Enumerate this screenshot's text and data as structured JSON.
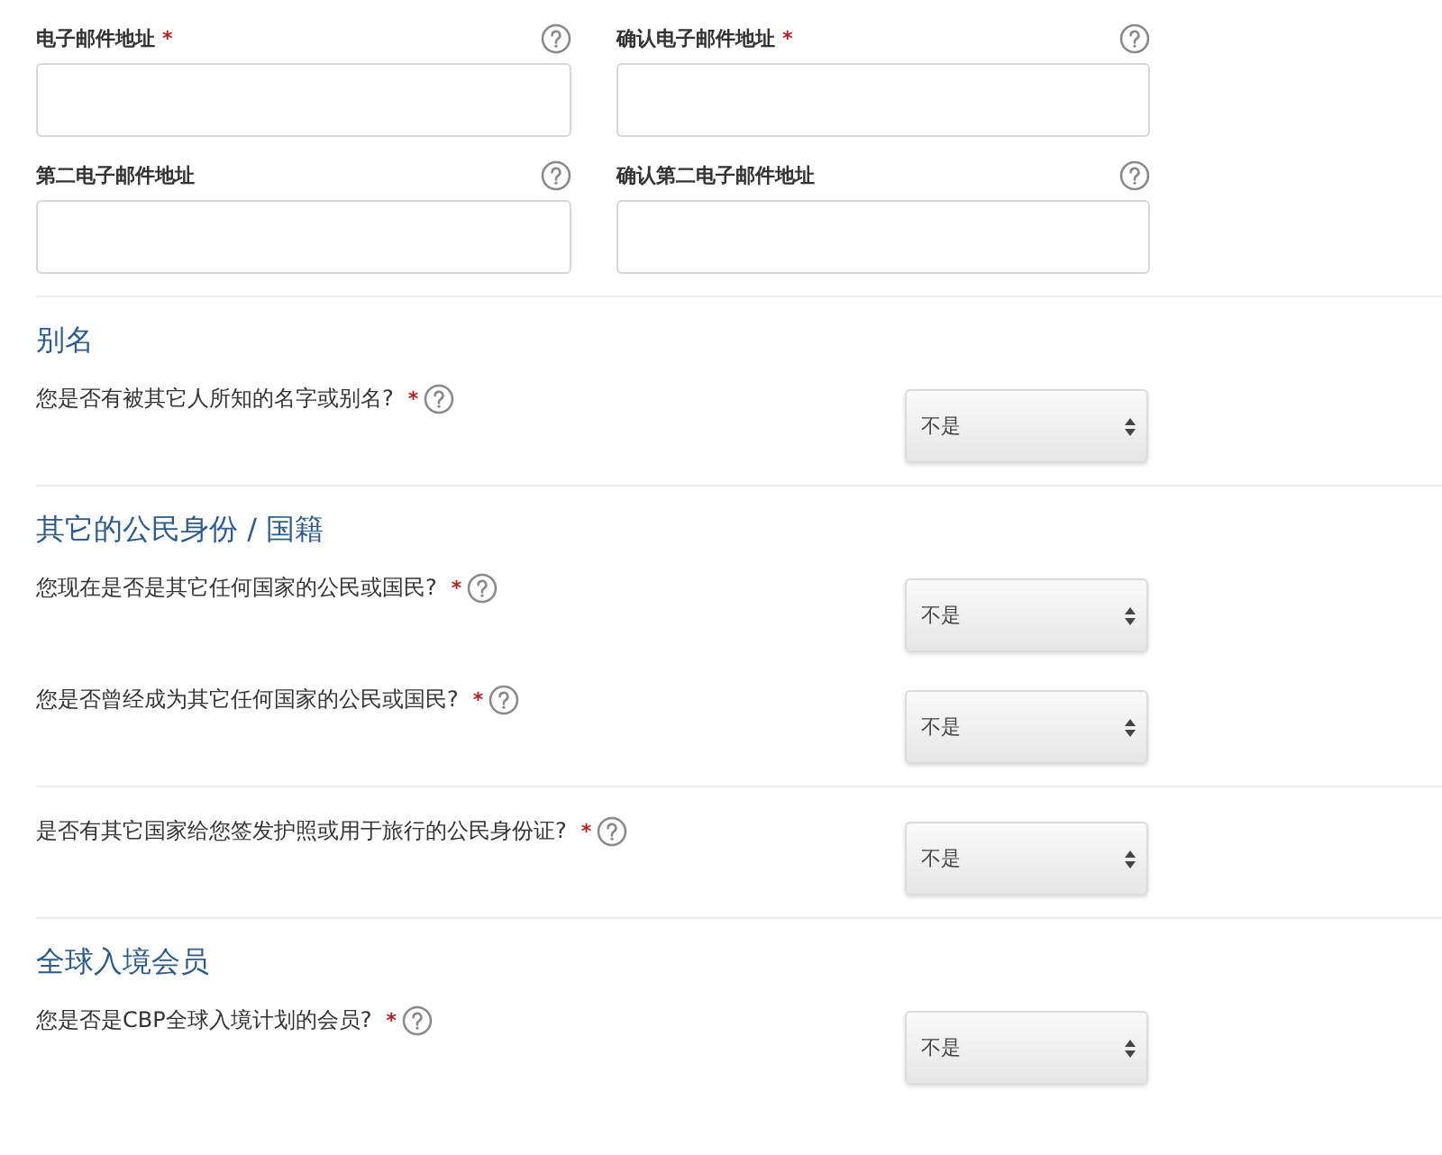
{
  "email_fields": [
    {
      "label": "电子邮件地址",
      "marker": "*"
    },
    {
      "label": "确认电子邮件地址",
      "marker": "*"
    },
    {
      "label": "第二电子邮件地址"
    },
    {
      "label": "确认第二电子邮件地址"
    }
  ],
  "groups": [
    {
      "heading": "别名",
      "questions": [
        {
          "text": "您是否有被其它人所知的名字或别名?",
          "marker": "*",
          "value": "不是"
        }
      ]
    },
    {
      "heading": "其它的公民身份 / 国籍",
      "questions": [
        {
          "text": "您现在是否是其它任何国家的公民或国民?",
          "marker": "*",
          "value": "不是"
        },
        {
          "text": "您是否曾经成为其它任何国家的公民或国民?",
          "marker": "*",
          "value": "不是"
        }
      ]
    },
    {
      "questions": [
        {
          "text": "是否有其它国家给您签发护照或用于旅行的公民身份证?",
          "marker": "*",
          "value": "不是"
        }
      ]
    },
    {
      "heading": "全球入境会员",
      "questions": [
        {
          "text": "您是否是CBP全球入境计划的会员?",
          "marker": "*",
          "value": "不是"
        }
      ]
    }
  ]
}
